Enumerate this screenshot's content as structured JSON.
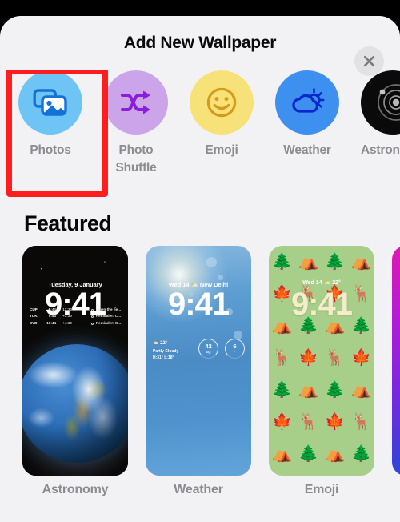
{
  "sheet": {
    "title": "Add New Wallpaper",
    "close_icon": "close-icon"
  },
  "categories": [
    {
      "label": "Photos",
      "icon": "photos-icon",
      "circle_color": "#6ec5f5",
      "glyph_color": "#1372d8",
      "selected": true
    },
    {
      "label": "Photo Shuffle",
      "icon": "shuffle-icon",
      "circle_color": "#cba4ea",
      "glyph_color": "#8b1fd9",
      "selected": false
    },
    {
      "label": "Emoji",
      "icon": "smiley-icon",
      "circle_color": "#f7e27a",
      "glyph_color": "#d79a1a",
      "selected": false
    },
    {
      "label": "Weather",
      "icon": "cloud-sun-icon",
      "circle_color": "#3d90f0",
      "glyph_color": "#0a27cc",
      "selected": false
    },
    {
      "label": "Astronomy",
      "icon": "orbit-icon",
      "circle_color": "#0a0a0a",
      "glyph_color": "#b9b9b9",
      "selected": false
    }
  ],
  "featured": {
    "heading": "Featured",
    "cards": [
      {
        "label": "Astronomy",
        "date": "Tuesday, 9 January",
        "time": "9:41",
        "world_clocks": [
          {
            "city": "CUP",
            "time": "5:44",
            "offset": "-12:30"
          },
          {
            "city": "TOK",
            "time": "9:44",
            "offset": "+3:30"
          },
          {
            "city": "SYD",
            "time": "10:44",
            "offset": "+4:30"
          }
        ],
        "reminders": [
          "When the ne...",
          "Reminder: C...",
          "Reminder: C..."
        ]
      },
      {
        "label": "Weather",
        "date": "Wed 14",
        "location": "New Delhi",
        "time": "9:41",
        "temperature": "22°",
        "condition": "Partly Cloudy",
        "high_low": "H:31° L:18°",
        "rings": [
          {
            "value": "42",
            "unit": "AQI"
          },
          {
            "value": "6",
            "unit": "°"
          }
        ]
      },
      {
        "label": "Emoji",
        "date": "Wed 14  ⛅ 22°",
        "time": "9:41",
        "emojis": [
          "🌲",
          "⛺",
          "🌲",
          "⛺",
          "🍁",
          "🦌",
          "🍁",
          "🦌",
          "⛺",
          "🌲",
          "⛺",
          "🌲",
          "🦌",
          "🍁",
          "🦌",
          "🍁",
          "🌲",
          "⛺",
          "🌲",
          "⛺",
          "🍁",
          "🦌",
          "🍁",
          "🦌",
          "⛺",
          "🌲",
          "⛺",
          "🌲"
        ]
      },
      {
        "label": ""
      }
    ]
  },
  "annotation": {
    "highlight_color": "#ff1d1d",
    "target": "Photos"
  }
}
